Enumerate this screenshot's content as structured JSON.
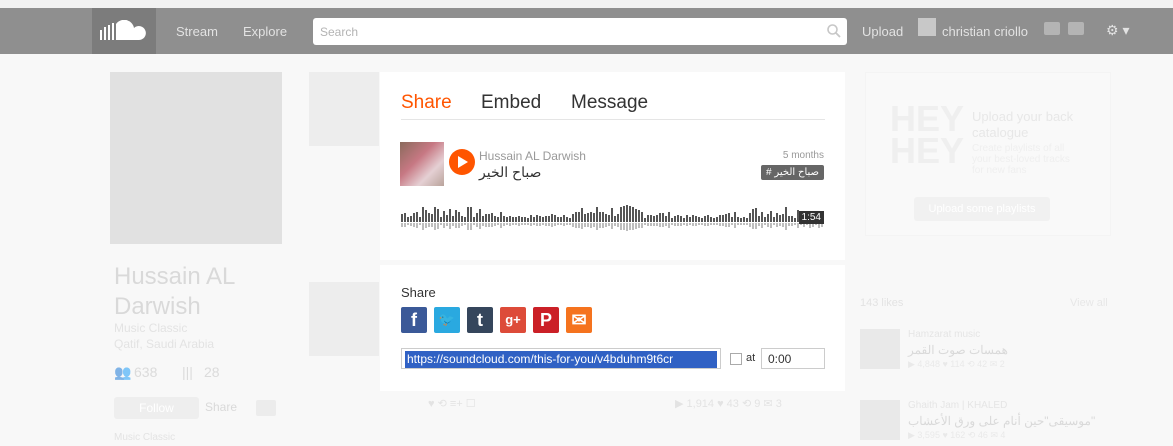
{
  "header": {
    "nav": [
      "Stream",
      "Explore"
    ],
    "search_placeholder": "Search",
    "upload_label": "Upload",
    "username": "christian criollo"
  },
  "profile": {
    "name": "Hussain AL Darwish",
    "genre": "Music Classic",
    "location": "Qatif, Saudi Arabia",
    "followers": "638",
    "tracks": "28",
    "follow_label": "Follow",
    "share_label": "Share",
    "bio_heading": "Music Classic"
  },
  "sidebar": {
    "hey_logo": "HEY HEY",
    "upload_title": "Upload your back catalogue",
    "upload_desc": "Create playlists of all your best-loved tracks for new fans",
    "upload_button": "Upload some playlists",
    "likes_label": "143 likes",
    "view_all": "View all",
    "liked_tracks": [
      {
        "user": "Hamzarat music",
        "title": "همسات صوت القمر",
        "stats": "▶ 4,848  ♥ 114  ⟲ 42  ✉ 2"
      },
      {
        "user": "Ghaith Jam | KHALED",
        "title": "موسيقى\"حين أنام على ورق الأعشاب\"",
        "stats": "▶ 3,595  ♥ 162  ⟲ 46  ✉ 4"
      }
    ]
  },
  "background_track": {
    "actions": "♥  ⟲  ≡+  ☐",
    "stats": "▶ 1,914  ♥ 43  ⟲ 9  ✉ 3"
  },
  "modal": {
    "tabs": [
      {
        "label": "Share",
        "active": true
      },
      {
        "label": "Embed",
        "active": false
      },
      {
        "label": "Message",
        "active": false
      }
    ],
    "track": {
      "artist": "Hussain AL Darwish",
      "title": "صباح الخير",
      "posted": "5 months",
      "tag": "# صباح الخير",
      "duration": "1:54"
    },
    "share": {
      "heading": "Share",
      "networks": [
        {
          "name": "facebook-icon",
          "glyph": "f",
          "color": "#3b5998"
        },
        {
          "name": "twitter-icon",
          "glyph": "🐦",
          "color": "#2aa9e0"
        },
        {
          "name": "tumblr-icon",
          "glyph": "t",
          "color": "#35465c"
        },
        {
          "name": "google-plus-icon",
          "glyph": "g+",
          "color": "#dd4b39"
        },
        {
          "name": "pinterest-icon",
          "glyph": "P",
          "color": "#cb2027"
        },
        {
          "name": "email-icon",
          "glyph": "✉",
          "color": "#f5731e"
        }
      ],
      "url": "https://soundcloud.com/this-for-you/v4bduhm9t6cr",
      "at_label": "at",
      "at_time": "0:00"
    }
  },
  "colors": {
    "accent": "#ff5500",
    "topbar": "#333333"
  }
}
